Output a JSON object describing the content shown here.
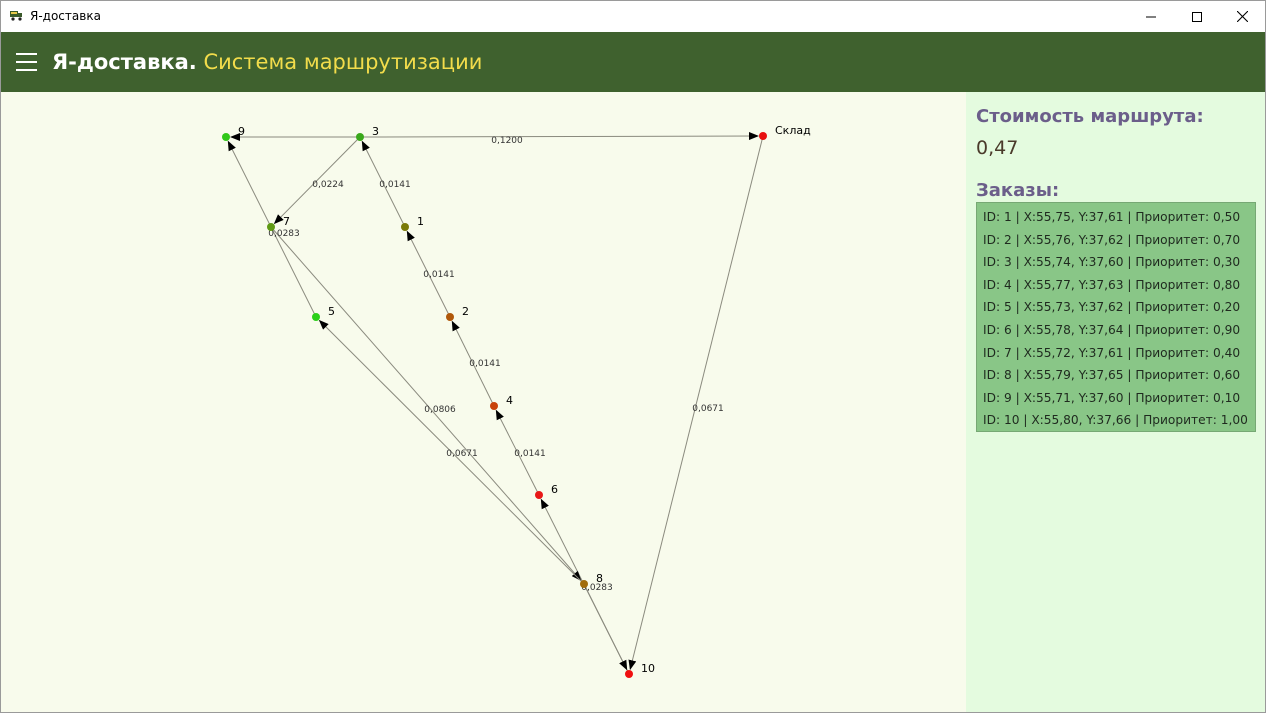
{
  "window": {
    "title": "Я-доставка"
  },
  "header": {
    "brand": "Я-доставка.",
    "subtitle": "Система маршрутизации"
  },
  "panel": {
    "cost_label": "Стоимость маршрута:",
    "cost_value": "0,47",
    "orders_label": "Заказы:",
    "orders": [
      "ID: 1 | X:55,75, Y:37,61 | Приоритет: 0,50",
      "ID: 2 | X:55,76, Y:37,62 | Приоритет: 0,70",
      "ID: 3 | X:55,74, Y:37,60 | Приоритет: 0,30",
      "ID: 4 | X:55,77, Y:37,63 | Приоритет: 0,80",
      "ID: 5 | X:55,73, Y:37,62 | Приоритет: 0,20",
      "ID: 6 | X:55,78, Y:37,64 | Приоритет: 0,90",
      "ID: 7 | X:55,72, Y:37,61 | Приоритет: 0,40",
      "ID: 8 | X:55,79, Y:37,65 | Приоритет: 0,60",
      "ID: 9 | X:55,71, Y:37,60 | Приоритет: 0,10",
      "ID: 10 | X:55,80, Y:37,66 | Приоритет: 1,00"
    ]
  },
  "map": {
    "nodes": [
      {
        "id": "warehouse",
        "label": "Склад",
        "color": "#e81010"
      },
      {
        "id": "9",
        "label": "9",
        "color": "#31c81a"
      },
      {
        "id": "3",
        "label": "3",
        "color": "#3aa81b"
      },
      {
        "id": "7",
        "label": "7",
        "color": "#5f9a14"
      },
      {
        "id": "1",
        "label": "1",
        "color": "#7a7a08"
      },
      {
        "id": "5",
        "label": "5",
        "color": "#2bd01a"
      },
      {
        "id": "2",
        "label": "2",
        "color": "#b0580a"
      },
      {
        "id": "4",
        "label": "4",
        "color": "#c8420a"
      },
      {
        "id": "6",
        "label": "6",
        "color": "#e81818"
      },
      {
        "id": "8",
        "label": "8",
        "color": "#a06c0c"
      },
      {
        "id": "10",
        "label": "10",
        "color": "#f01010"
      }
    ],
    "edges": [
      {
        "from": "3",
        "to": "warehouse",
        "weight": "0,1200"
      },
      {
        "from": "3",
        "to": "9",
        "weight": ""
      },
      {
        "from": "3",
        "to": "7",
        "weight": "0,0224"
      },
      {
        "from": "1",
        "to": "3",
        "weight": "0,0141"
      },
      {
        "from": "2",
        "to": "1",
        "weight": "0,0141"
      },
      {
        "from": "4",
        "to": "2",
        "weight": "0,0141"
      },
      {
        "from": "6",
        "to": "4",
        "weight": "0,0141"
      },
      {
        "from": "10",
        "to": "6",
        "weight": ""
      },
      {
        "from": "7",
        "to": "8",
        "weight": "0,0806"
      },
      {
        "from": "5",
        "to": "9",
        "weight": ""
      },
      {
        "from": "8",
        "to": "5",
        "weight": "0,0671"
      },
      {
        "from": "8",
        "to": "10",
        "weight": "0,0283"
      },
      {
        "from": "warehouse",
        "to": "10",
        "weight": "0,0671"
      }
    ],
    "extra_labels": [
      {
        "text": "0,0283"
      }
    ]
  }
}
